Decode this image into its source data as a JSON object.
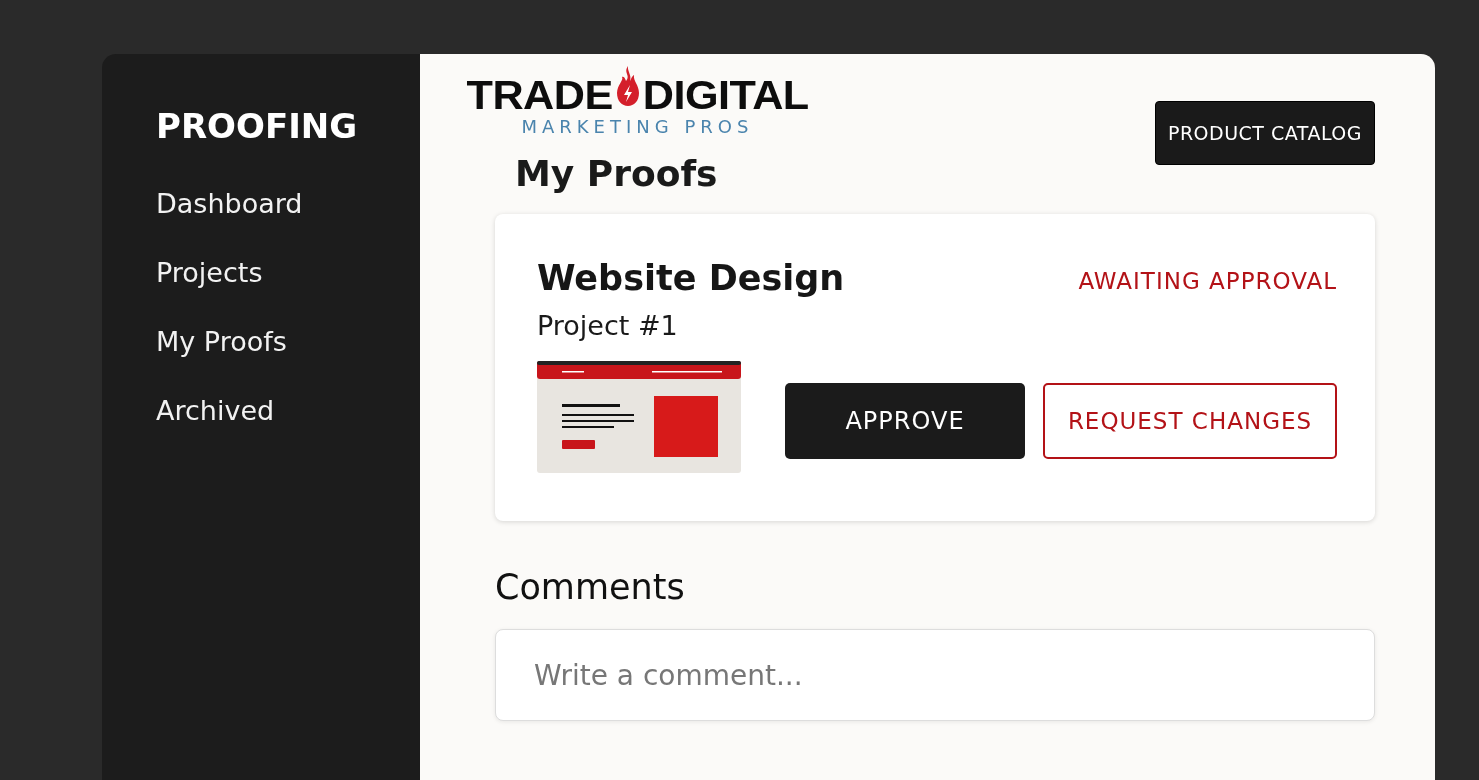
{
  "sidebar": {
    "title": "PROOFING",
    "items": [
      {
        "label": "Dashboard",
        "selected": false
      },
      {
        "label": "Projects",
        "selected": false
      },
      {
        "label": "My Proofs",
        "selected": false
      },
      {
        "label": "Archived",
        "selected": false
      }
    ]
  },
  "logo": {
    "word_1": "TRADE",
    "word_2": "DIGITAL",
    "tagline": "MARKETING PROS"
  },
  "header_button": "PRODUCT CATALOG",
  "page_title": "My Proofs",
  "proof": {
    "title": "Website Design",
    "status": "AWAITING APPROVAL",
    "project": "Project #1",
    "approve": "APPROVE",
    "request": "REQUEST CHANGES"
  },
  "comments": {
    "title": "Comments",
    "placeholder": "Write a comment..."
  }
}
